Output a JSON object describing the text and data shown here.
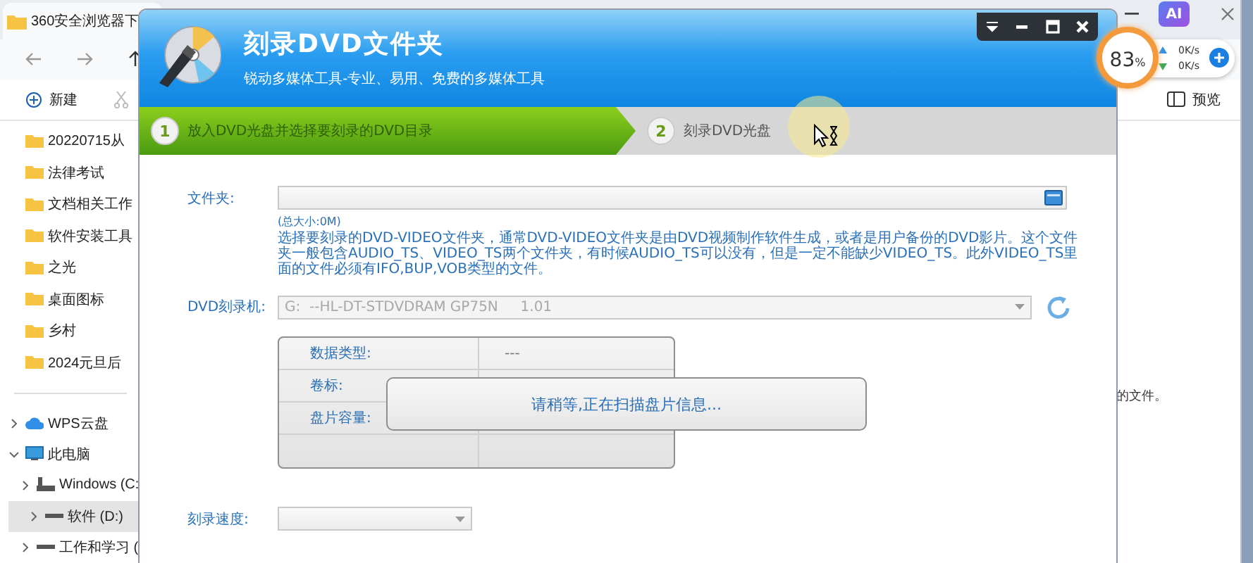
{
  "explorer": {
    "tab_title": "360安全浏览器下",
    "new_button": "新建",
    "preview_button": "预览",
    "content_text": "的文件。",
    "ai_button": "AI",
    "sidebar": [
      {
        "label": "20220715从",
        "kind": "folder",
        "selected": false
      },
      {
        "label": "法律考试",
        "kind": "folder",
        "selected": false
      },
      {
        "label": "文档相关工作",
        "kind": "folder",
        "selected": false
      },
      {
        "label": "软件安装工具",
        "kind": "folder",
        "selected": false
      },
      {
        "label": "之光",
        "kind": "folder",
        "selected": false
      },
      {
        "label": "桌面图标",
        "kind": "folder",
        "selected": false
      },
      {
        "label": "乡村",
        "kind": "folder",
        "selected": false
      },
      {
        "label": "2024元旦后",
        "kind": "folder",
        "selected": false
      }
    ],
    "tree": [
      {
        "label": "WPS云盘",
        "kind": "cloud",
        "expanded": false,
        "selected": false
      },
      {
        "label": "此电脑",
        "kind": "pc",
        "expanded": true,
        "selected": false,
        "children": [
          {
            "label": "Windows (C:",
            "kind": "system-drive",
            "expanded": false,
            "selected": false
          },
          {
            "label": "软件 (D:)",
            "kind": "drive",
            "expanded": false,
            "selected": true
          },
          {
            "label": "工作和学习 (",
            "kind": "drive",
            "expanded": false,
            "selected": false
          }
        ]
      }
    ]
  },
  "monitor": {
    "percent": "83",
    "unit": "%",
    "upload": "0K/s",
    "download": "0K/s"
  },
  "dialog": {
    "title": "刻录DVD文件夹",
    "subtitle": "锐动多媒体工具-专业、易用、免费的多媒体工具",
    "steps": [
      {
        "number": "1",
        "label": "放入DVD光盘并选择要刻录的DVD目录",
        "selected": true
      },
      {
        "number": "2",
        "label": "刻录DVD光盘",
        "selected": false
      }
    ],
    "folder_label": "文件夹:",
    "total_size": "(总大小:0M)",
    "description": "选择要刻录的DVD-VIDEO文件夹，通常DVD-VIDEO文件夹是由DVD视频制作软件生成，或者是用户备份的DVD影片。这个文件夹一般包含AUDIO_TS、VIDEO_TS两个文件夹，有时候AUDIO_TS可以没有，但是一定不能缺少VIDEO_TS。此外VIDEO_TS里面的文件必须有IFO,BUP,VOB类型的文件。",
    "drive_label": "DVD刻录机:",
    "drive_value": "G:  --HL-DT-STDVDRAM GP75N     1.01",
    "drive_disabled": true,
    "info_rows": [
      {
        "label": "数据类型:",
        "value": "---"
      },
      {
        "label": "卷标:"
      },
      {
        "label": "盘片容量:"
      },
      {}
    ],
    "scan_message": "请稍等,正在扫描盘片信息...",
    "speed_label": "刻录速度:"
  }
}
